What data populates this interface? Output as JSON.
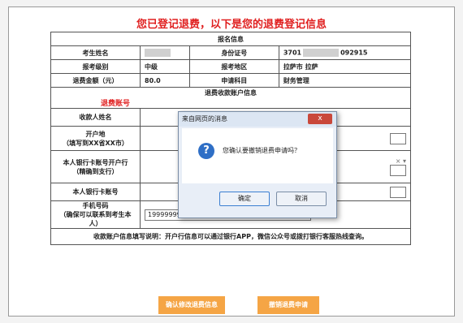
{
  "header": {
    "title": "您已登记退费，以下是您的退费登记信息"
  },
  "section1": "报名信息",
  "rows": [
    [
      "考生姓名",
      "",
      "身份证号",
      "3701",
      "092915"
    ],
    [
      "报考级别",
      "中级",
      "报考地区",
      "拉萨市 拉萨"
    ],
    [
      "退费金额（元）",
      "80.0",
      "申请科目",
      "财务管理"
    ]
  ],
  "section2": "退费收款账户信息",
  "refund_note": "退费账号",
  "bank": {
    "payee_label": "收款人姓名",
    "location_label": "开户地",
    "location_hint": "（填写到XX省XX市）",
    "branch_label": "本人银行卡账号开户行",
    "branch_hint": "（精确到支行）",
    "card_label": "本人银行卡账号",
    "phone_label": "手机号码",
    "phone_hint": "（确保可以联系到考生本人）",
    "phone_value": "19999999999",
    "select_suffix": "× ▾",
    "note": "收款账户信息填写说明：开户行信息可以通过银行APP，微信公众号或拨打银行客服热线查询。"
  },
  "actions": {
    "confirm": "确认修改退费信息",
    "cancel": "撤销退费申请"
  },
  "dialog": {
    "title": "来自网页的消息",
    "close": "x",
    "message": "您确认要撤销退费申请吗？",
    "ok": "确定",
    "cancel": "取消"
  },
  "colors": {
    "accent_red": "#e02020",
    "button_orange": "#f5a545",
    "dialog_blue": "#2f6fc6"
  }
}
